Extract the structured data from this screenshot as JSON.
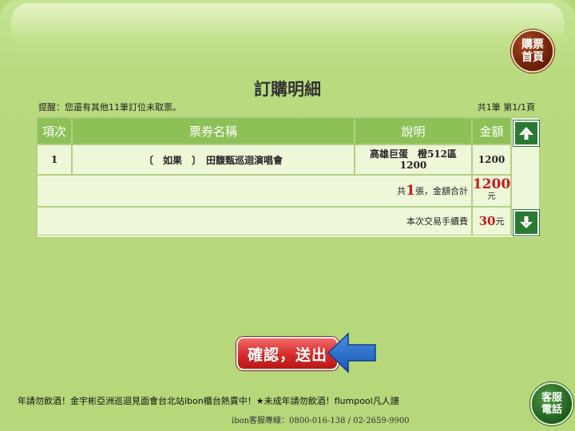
{
  "header": {
    "home_button_line1": "購票",
    "home_button_line2": "首頁",
    "title": "訂購明細"
  },
  "info": {
    "reminder": "提醒：您還有其他11筆訂位未取票。",
    "page_info": "共1筆 第1/1頁"
  },
  "table": {
    "headers": [
      "項次",
      "票券名稱",
      "說明",
      "金額"
    ],
    "rows": [
      {
        "index": "1",
        "name": "〔　如果　〕　田馥甄巡迴演唱會",
        "desc_line1": "高雄巨蛋　橙512區",
        "desc_line2": "1200",
        "amount": "1200"
      }
    ],
    "total": {
      "prefix": "共",
      "count": "1",
      "suffix": "張，金額合計",
      "amount": "1200",
      "unit": "元"
    },
    "fee": {
      "label": "本次交易手續費",
      "amount": "30",
      "unit": "元"
    }
  },
  "confirm_button": "確認，送出",
  "footer": {
    "marquee": "年請勿飲酒！金宇彬亞洲巡迴見面會台北站ibon櫃台熱賣中！★未成年請勿飲酒！flumpool凡人譜",
    "hotline": "ibon客服專線：0800-016-138 / 02-2659-9900",
    "cs_button_line1": "客服",
    "cs_button_line2": "電話"
  },
  "colors": {
    "background": "#b6d77a",
    "header_cell": "#8dc157",
    "body_cell": "#eef7d8",
    "accent_red": "#c8191b",
    "arrow_green": "#2b7a33"
  },
  "icons": [
    "up-arrow-icon",
    "down-arrow-icon",
    "pointer-arrow-icon"
  ]
}
